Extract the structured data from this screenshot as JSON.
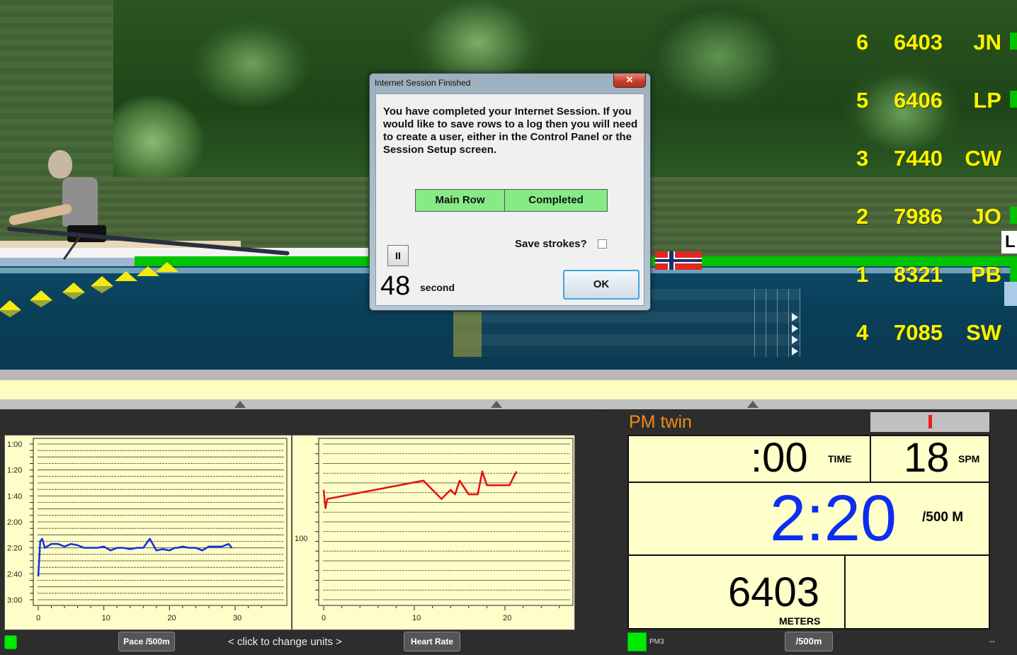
{
  "leaderboard": [
    {
      "place": "6",
      "distance": "6403",
      "initials": "JN"
    },
    {
      "place": "5",
      "distance": "6406",
      "initials": "LP"
    },
    {
      "place": "3",
      "distance": "7440",
      "initials": "CW"
    },
    {
      "place": "2",
      "distance": "7986",
      "initials": "JO"
    },
    {
      "place": "1",
      "distance": "8321",
      "initials": "PB"
    },
    {
      "place": "4",
      "distance": "7085",
      "initials": "SW"
    }
  ],
  "lane_label": "L",
  "dialog": {
    "title": "Internet Session Finished",
    "close_label": "✕",
    "message": "You have completed your Internet Session.  If you would like to save rows to a log then you will need to create a user, either in the Control Panel or the Session Setup screen.",
    "status_name": "Main Row",
    "status_value": "Completed",
    "save_strokes_label": "Save strokes?",
    "save_strokes_checked": false,
    "pause_label": "II",
    "countdown": "48",
    "countdown_unit": "second",
    "ok_label": "OK"
  },
  "graph_footer": {
    "pace_button": "Pace /500m",
    "hint": "<  click to change units  >",
    "hr_button": "Heart Rate"
  },
  "chart_data": [
    {
      "type": "line",
      "title": "",
      "series_name": "Pace /500m",
      "color": "#1030e0",
      "xlabel": "",
      "ylabel": "",
      "xlim": [
        0,
        35
      ],
      "ylim_seconds": [
        60,
        180
      ],
      "y_inverted": true,
      "yticks": [
        "1:00",
        "1:20",
        "1:40",
        "2:00",
        "2:20",
        "2:40",
        "3:00"
      ],
      "xticks": [
        "0",
        "10",
        "20",
        "30"
      ],
      "x": [
        0,
        0.3,
        0.6,
        1,
        2,
        3,
        4,
        5,
        6,
        7,
        8,
        9,
        10,
        11,
        12,
        13,
        14,
        15,
        16,
        17,
        18,
        19,
        20,
        20.8,
        21.2,
        22,
        23,
        24,
        25,
        26,
        27,
        28,
        29,
        29.5
      ],
      "y_seconds": [
        162,
        135,
        133,
        140,
        137,
        137,
        139,
        137,
        138,
        140,
        140,
        140,
        139,
        142,
        140,
        140,
        141,
        140,
        140,
        133,
        142,
        141,
        142,
        140,
        140,
        139,
        140,
        140,
        142,
        139,
        139,
        139,
        137,
        140
      ]
    },
    {
      "type": "line",
      "title": "",
      "series_name": "Heart Rate",
      "color": "#e41010",
      "xlim": [
        0,
        27
      ],
      "ylim": [
        84,
        118
      ],
      "yticks": [
        "100"
      ],
      "xticks": [
        "0",
        "10",
        "20"
      ],
      "x": [
        0,
        0.2,
        0.4,
        11,
        13,
        14,
        14.5,
        15,
        16,
        17,
        17.5,
        18,
        20.5,
        21,
        21.3
      ],
      "y": [
        108,
        104,
        106,
        110,
        106,
        108,
        107,
        110,
        107,
        107,
        112,
        109,
        109,
        111,
        112
      ]
    }
  ],
  "pm": {
    "title": "PM twin",
    "time": ":00",
    "time_label": "TIME",
    "spm": "18",
    "spm_label": "SPM",
    "pace": "2:20",
    "pace_label": "/500 M",
    "meters": "6403",
    "meters_label": "METERS",
    "device_label": "PM3",
    "units_button": "/500m",
    "status_text": "--"
  },
  "colors": {
    "accent_orange": "#f08b16",
    "pace_blue": "#0d2df0",
    "leader_yellow": "#f8f400",
    "status_green": "#00ea00"
  }
}
